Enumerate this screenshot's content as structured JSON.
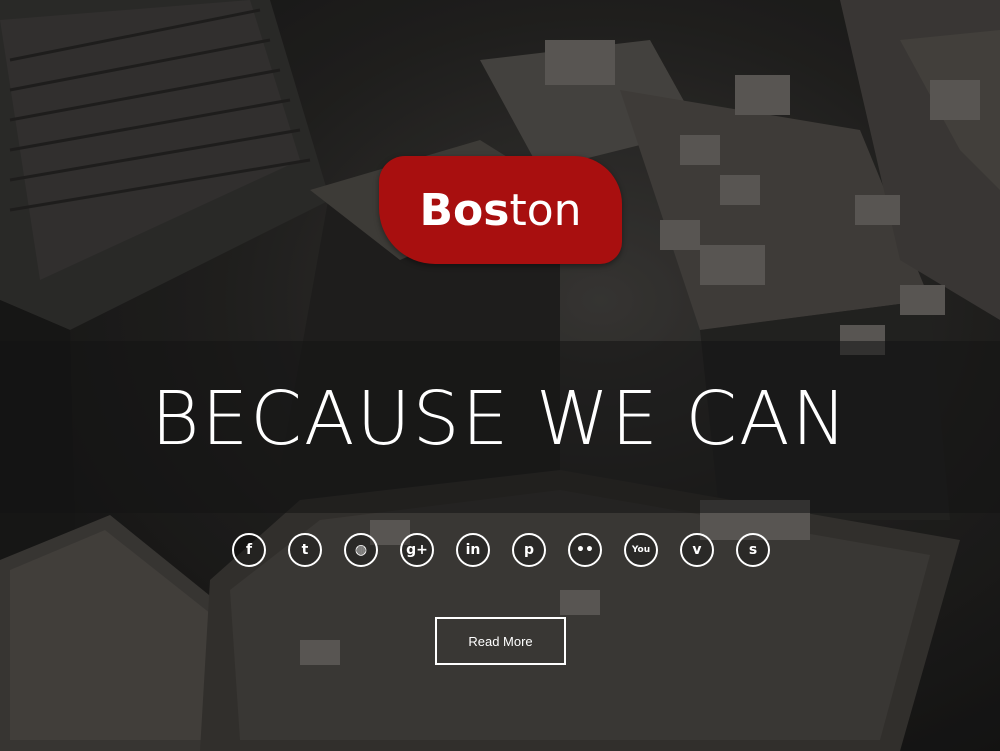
{
  "brand": {
    "logo_part1": "Bos",
    "logo_part2": "ton",
    "logo_color": "#a80f0f"
  },
  "hero": {
    "headline": "BECAUSE WE CAN",
    "button_label": "Read More"
  },
  "social": [
    {
      "name": "facebook-icon",
      "glyph": "f"
    },
    {
      "name": "twitter-icon",
      "glyph": "t"
    },
    {
      "name": "dribbble-icon",
      "glyph": "◍"
    },
    {
      "name": "google-plus-icon",
      "glyph": "g+"
    },
    {
      "name": "linkedin-icon",
      "glyph": "in"
    },
    {
      "name": "pinterest-icon",
      "glyph": "p"
    },
    {
      "name": "flickr-icon",
      "glyph": "••"
    },
    {
      "name": "youtube-icon",
      "glyph": "You"
    },
    {
      "name": "vimeo-icon",
      "glyph": "v"
    },
    {
      "name": "skype-icon",
      "glyph": "s"
    }
  ]
}
